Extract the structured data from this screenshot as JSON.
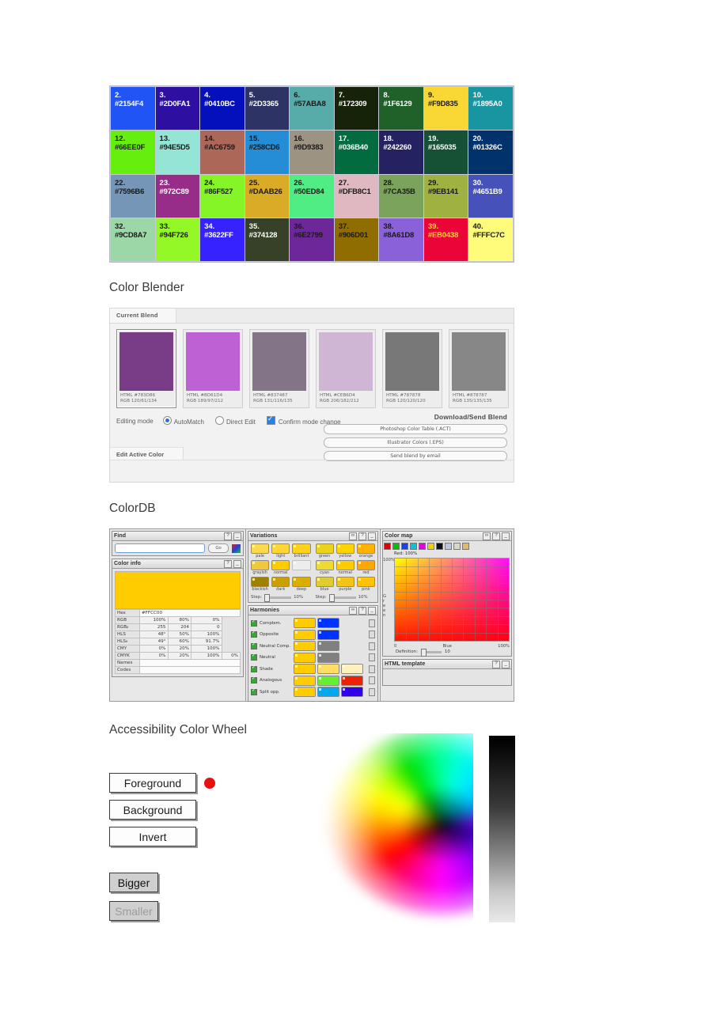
{
  "swatches": [
    {
      "n": "2.",
      "hex": "#2154F4",
      "bg": "#2154F4",
      "fg": "#ffffff"
    },
    {
      "n": "3.",
      "hex": "#2D0FA1",
      "bg": "#2D0FA1",
      "fg": "#ffffff"
    },
    {
      "n": "4.",
      "hex": "#0410BC",
      "bg": "#0410BC",
      "fg": "#ffffff"
    },
    {
      "n": "5.",
      "hex": "#2D3365",
      "bg": "#2D3365",
      "fg": "#ffffff"
    },
    {
      "n": "6.",
      "hex": "#57ABA8",
      "bg": "#57ABA8",
      "fg": "#1a1a1a"
    },
    {
      "n": "7.",
      "hex": "#172309",
      "bg": "#172309",
      "fg": "#ffffff"
    },
    {
      "n": "8.",
      "hex": "#1F6129",
      "bg": "#1F6129",
      "fg": "#ffffff"
    },
    {
      "n": "9.",
      "hex": "#F9D835",
      "bg": "#F9D835",
      "fg": "#1a1a1a"
    },
    {
      "n": "10.",
      "hex": "#1895A0",
      "bg": "#1895A0",
      "fg": "#ffffff"
    },
    {
      "n": "12.",
      "hex": "#66EE0F",
      "bg": "#66EE0F",
      "fg": "#1a1a1a"
    },
    {
      "n": "13.",
      "hex": "#94E5D5",
      "bg": "#94E5D5",
      "fg": "#1a1a1a"
    },
    {
      "n": "14.",
      "hex": "#AC6759",
      "bg": "#AC6759",
      "fg": "#1a1a1a"
    },
    {
      "n": "15.",
      "hex": "#258CD6",
      "bg": "#258CD6",
      "fg": "#1a1a1a"
    },
    {
      "n": "16.",
      "hex": "#9D9383",
      "bg": "#9D9383",
      "fg": "#1a1a1a"
    },
    {
      "n": "17.",
      "hex": "#036B40",
      "bg": "#036B40",
      "fg": "#ffffff"
    },
    {
      "n": "18.",
      "hex": "#242260",
      "bg": "#242260",
      "fg": "#ffffff"
    },
    {
      "n": "19.",
      "hex": "#165035",
      "bg": "#165035",
      "fg": "#ffffff"
    },
    {
      "n": "20.",
      "hex": "#01326C",
      "bg": "#01326C",
      "fg": "#ffffff"
    },
    {
      "n": "22.",
      "hex": "#7596B6",
      "bg": "#7596B6",
      "fg": "#1a1a1a"
    },
    {
      "n": "23.",
      "hex": "#972C89",
      "bg": "#972C89",
      "fg": "#ffffff"
    },
    {
      "n": "24.",
      "hex": "#86F527",
      "bg": "#86F527",
      "fg": "#1a1a1a"
    },
    {
      "n": "25.",
      "hex": "#DAAB26",
      "bg": "#DAAB26",
      "fg": "#1a1a1a"
    },
    {
      "n": "26.",
      "hex": "#50ED84",
      "bg": "#50ED84",
      "fg": "#1a1a1a"
    },
    {
      "n": "27.",
      "hex": "#DFB8C1",
      "bg": "#DFB8C1",
      "fg": "#1a1a1a"
    },
    {
      "n": "28.",
      "hex": "#7CA35B",
      "bg": "#7CA35B",
      "fg": "#1a1a1a"
    },
    {
      "n": "29.",
      "hex": "#9EB141",
      "bg": "#9EB141",
      "fg": "#1a1a1a"
    },
    {
      "n": "30.",
      "hex": "#4651B9",
      "bg": "#4651B9",
      "fg": "#ffffff"
    },
    {
      "n": "32.",
      "hex": "#9CD8A7",
      "bg": "#9CD8A7",
      "fg": "#1a1a1a"
    },
    {
      "n": "33.",
      "hex": "#94F726",
      "bg": "#94F726",
      "fg": "#1a1a1a"
    },
    {
      "n": "34.",
      "hex": "#3622FF",
      "bg": "#3622FF",
      "fg": "#ffffff"
    },
    {
      "n": "35.",
      "hex": "#374128",
      "bg": "#374128",
      "fg": "#ffffff"
    },
    {
      "n": "36.",
      "hex": "#6E2799",
      "bg": "#6E2799",
      "fg": "#1a1a1a"
    },
    {
      "n": "37.",
      "hex": "#906D01",
      "bg": "#906D01",
      "fg": "#1a1a1a"
    },
    {
      "n": "38.",
      "hex": "#8A61D8",
      "bg": "#8A61D8",
      "fg": "#1a1a1a"
    },
    {
      "n": "39.",
      "hex": "#EB0438",
      "bg": "#EB0438",
      "fg": "#F9D835"
    },
    {
      "n": "40.",
      "hex": "#FFFC7C",
      "bg": "#FFFC7C",
      "fg": "#1a1a1a"
    }
  ],
  "headings": {
    "blender": "Color Blender",
    "colordb": "ColorDB",
    "wheel": "Accessibility Color Wheel"
  },
  "blender": {
    "tab_current": "Current Blend",
    "tab_edit": "Edit Active Color",
    "swatches": [
      {
        "color": "#783D86",
        "html": "HTML #783D86",
        "rgb": "RGB 120/61/134"
      },
      {
        "color": "#BD61D4",
        "html": "HTML #BD61D4",
        "rgb": "RGB 189/97/212"
      },
      {
        "color": "#837487",
        "html": "HTML #837487",
        "rgb": "RGB 131/116/135"
      },
      {
        "color": "#CEB6D4",
        "html": "HTML #CEB6D4",
        "rgb": "RGB 206/182/212"
      },
      {
        "color": "#787878",
        "html": "HTML #787878",
        "rgb": "RGB 120/120/120"
      },
      {
        "color": "#878787",
        "html": "HTML #878787",
        "rgb": "RGB 135/135/135"
      }
    ],
    "editing_label": "Editing mode",
    "automatch": "AutoMatch",
    "direct_edit": "Direct Edit",
    "confirm": "Confirm mode change",
    "download_title": "Download/Send Blend",
    "buttons": [
      "Photoshop Color Table (.ACT)",
      "Illustrator Colors (.EPS)",
      "Send blend by email"
    ]
  },
  "colordb": {
    "find": {
      "title": "Find",
      "go": "Go",
      "value": "",
      "placeholder": ""
    },
    "color_info": {
      "title": "Color info",
      "swatch": "#FFCC00",
      "rows": [
        {
          "k": "Hex",
          "cells": [
            "#FFCC00"
          ],
          "type": "wide"
        },
        {
          "k": "RGB",
          "cells": [
            "100%",
            "80%",
            "0%"
          ]
        },
        {
          "k": "RGB₈",
          "cells": [
            "255",
            "204",
            "0"
          ]
        },
        {
          "k": "HLS",
          "cells": [
            "48°",
            "50%",
            "100%"
          ]
        },
        {
          "k": "HLS₈",
          "cells": [
            "49°",
            "60%",
            "91.7%"
          ]
        },
        {
          "k": "CMY",
          "cells": [
            "0%",
            "20%",
            "100%"
          ]
        },
        {
          "k": "CMYK",
          "cells": [
            "0%",
            "20%",
            "100%",
            "0%"
          ]
        },
        {
          "k": "Names",
          "cells": [
            ""
          ],
          "type": "wide"
        },
        {
          "k": "Codes",
          "cells": [
            ""
          ],
          "type": "wide"
        }
      ]
    },
    "variations": {
      "title": "Variations",
      "left": [
        [
          {
            "l": "pale",
            "c": "#FFD94D"
          },
          {
            "l": "light",
            "c": "#FFD633"
          },
          {
            "l": "brilliant",
            "c": "#FFD11A"
          }
        ],
        [
          {
            "l": "grayish",
            "c": "#F0C83D"
          },
          {
            "l": "normal",
            "c": "#FFCC00"
          },
          {
            "l": "",
            "c": "#EDEDED"
          }
        ],
        [
          {
            "l": "blackish",
            "c": "#A08000"
          },
          {
            "l": "dark",
            "c": "#C9A000"
          },
          {
            "l": "deep",
            "c": "#D9AE00"
          }
        ]
      ],
      "right": [
        [
          {
            "l": "green",
            "c": "#EDD21A"
          },
          {
            "l": "yellow",
            "c": "#FFD400"
          },
          {
            "l": "orange",
            "c": "#FFB300"
          }
        ],
        [
          {
            "l": "cyan",
            "c": "#EDDB33"
          },
          {
            "l": "normal",
            "c": "#FFCC00"
          },
          {
            "l": "red",
            "c": "#FFA600"
          }
        ],
        [
          {
            "l": "blue",
            "c": "#E0CC2E",
            "c2": "#E0CC2E"
          },
          {
            "l": "purple",
            "c": "#F2C417"
          },
          {
            "l": "pink",
            "c": "#FFC200"
          }
        ]
      ],
      "step_label": "Step:",
      "step_value": "10%"
    },
    "harmonies": {
      "title": "Harmonies",
      "rows": [
        {
          "label": "Complem.",
          "chips": [
            "#FFCC00",
            "#0033FF"
          ]
        },
        {
          "label": "Opposite",
          "chips": [
            "#FFCC00",
            "#0033FF"
          ]
        },
        {
          "label": "Neutral Comp.",
          "chips": [
            "#FFCC00",
            "#808080"
          ]
        },
        {
          "label": "Neutral",
          "chips": [
            "#FFCC00",
            "#808080"
          ]
        },
        {
          "label": "Shade",
          "chips": [
            "#FFCC00",
            "#FFDE66",
            "#FFF0BF"
          ]
        },
        {
          "label": "Analogous",
          "chips": [
            "#FFCC00",
            "#66EE33",
            "#EE2200"
          ]
        },
        {
          "label": "Split opp.",
          "chips": [
            "#FFCC00",
            "#00AAEE",
            "#3300EE"
          ]
        }
      ]
    },
    "color_map": {
      "title": "Color map",
      "channel_label": "Red:",
      "channel_value": "100%",
      "y_top": "100%",
      "y_axis": "Green",
      "x_left": "0",
      "x_label": "Blue",
      "x_right": "100%",
      "definition_label": "Definition:",
      "definition_value": "10"
    },
    "html_template": {
      "title": "HTML template"
    }
  },
  "wheel": {
    "foreground": "Foreground",
    "background": "Background",
    "invert": "Invert",
    "bigger": "Bigger",
    "smaller": "Smaller",
    "fg_color": "#e81010"
  }
}
